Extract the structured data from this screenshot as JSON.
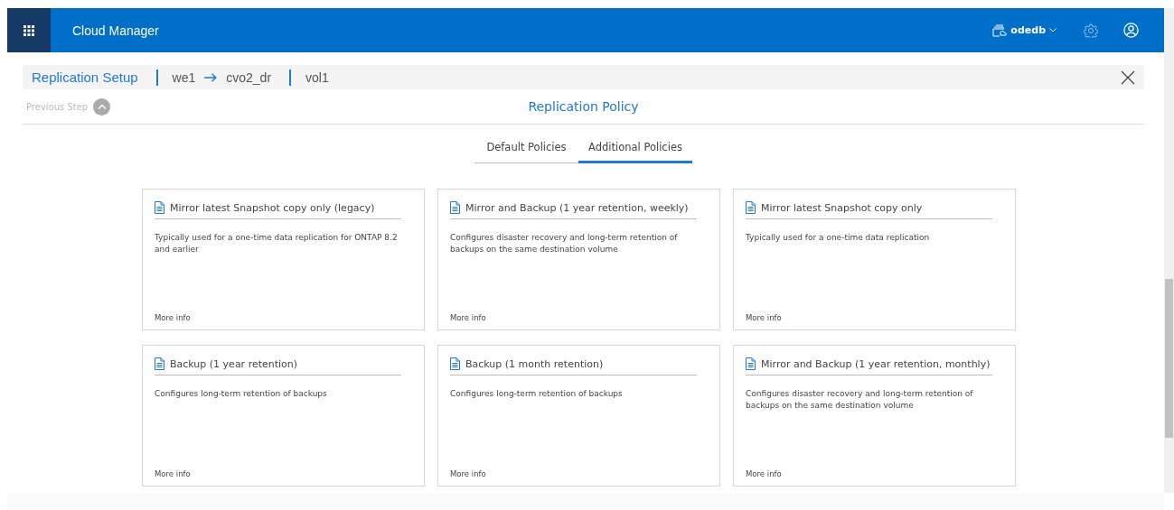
{
  "header": {
    "app_title": "Cloud Manager",
    "account": "odedb"
  },
  "breadcrumb": {
    "title": "Replication Setup",
    "source": "we1",
    "target": "cvo2_dr",
    "volume": "vol1"
  },
  "step": {
    "previous": "Previous Step",
    "title": "Replication Policy"
  },
  "tabs": [
    {
      "label": "Default Policies",
      "selected": false
    },
    {
      "label": "Additional Policies",
      "selected": true
    }
  ],
  "policies": [
    {
      "title": "Mirror latest Snapshot copy only (legacy)",
      "description": "Typically used for a one-time data replication for ONTAP 8.2 and earlier",
      "link": "More info"
    },
    {
      "title": "Mirror and Backup (1 year retention, weekly)",
      "description": "Configures disaster recovery and long-term retention of backups on the same destination volume",
      "link": "More info"
    },
    {
      "title": "Mirror latest Snapshot copy only",
      "description": "Typically used for a one-time data replication",
      "link": "More info"
    },
    {
      "title": "Backup (1 year retention)",
      "description": "Configures long-term retention of backups",
      "link": "More info"
    },
    {
      "title": "Backup (1 month retention)",
      "description": "Configures long-term retention of backups",
      "link": "More info"
    },
    {
      "title": "Mirror and Backup (1 year retention, monthly)",
      "description": "Configures disaster recovery and long-term retention of backups on the same destination volume",
      "link": "More info"
    }
  ]
}
